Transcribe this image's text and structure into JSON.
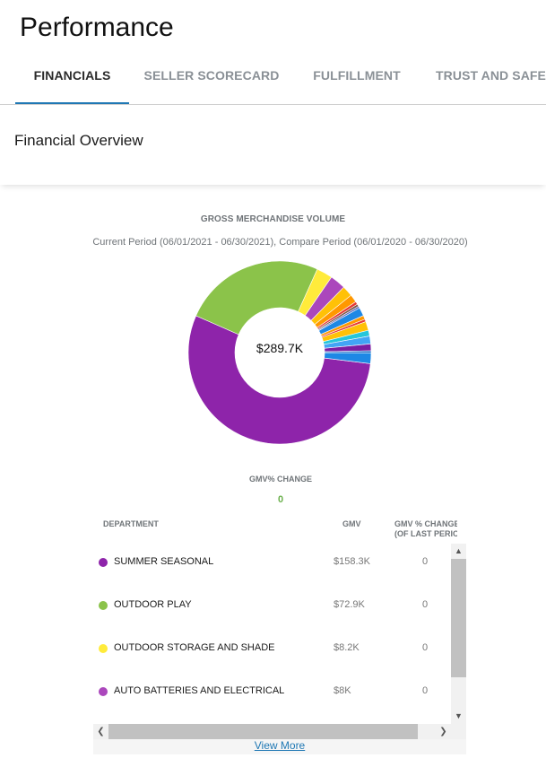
{
  "page": {
    "title": "Performance"
  },
  "tabs": [
    {
      "label": "FINANCIALS",
      "active": true
    },
    {
      "label": "SELLER SCORECARD",
      "active": false
    },
    {
      "label": "FULFILLMENT",
      "active": false
    },
    {
      "label": "TRUST AND SAFETY",
      "active": false
    }
  ],
  "section": {
    "title": "Financial Overview"
  },
  "gmv_chart": {
    "title": "GROSS MERCHANDISE VOLUME",
    "period": "Current Period (06/01/2021 - 06/30/2021), Compare Period (06/01/2020 - 06/30/2020)",
    "center_label": "$289.7K"
  },
  "gmv_change": {
    "label": "GMV% CHANGE",
    "value": "0"
  },
  "table": {
    "headers": {
      "department": "DEPARTMENT",
      "gmv": "GMV",
      "change": "GMV % CHANGE (OF LAST PERIOD)"
    },
    "rows": [
      {
        "department": "SUMMER SEASONAL",
        "gmv": "$158.3K",
        "change": "0",
        "color": "#8e24aa"
      },
      {
        "department": "OUTDOOR PLAY",
        "gmv": "$72.9K",
        "change": "0",
        "color": "#8bc34a"
      },
      {
        "department": "OUTDOOR STORAGE AND SHADE",
        "gmv": "$8.2K",
        "change": "0",
        "color": "#ffeb3b"
      },
      {
        "department": "AUTO BATTERIES AND ELECTRICAL",
        "gmv": "$8K",
        "change": "0",
        "color": "#ab47bc"
      }
    ]
  },
  "view_more": {
    "label": "View More"
  },
  "chart_data": {
    "type": "pie",
    "center_label": "$289.7K",
    "slices": [
      {
        "value": 158.3,
        "color": "#8e24aa",
        "name": "SUMMER SEASONAL"
      },
      {
        "value": 72.9,
        "color": "#8bc34a",
        "name": "OUTDOOR PLAY"
      },
      {
        "value": 8.2,
        "color": "#ffeb3b",
        "name": "OUTDOOR STORAGE AND SHADE"
      },
      {
        "value": 8.0,
        "color": "#ab47bc",
        "name": "AUTO BATTERIES AND ELECTRICAL"
      },
      {
        "value": 5.5,
        "color": "#ffc107"
      },
      {
        "value": 4.0,
        "color": "#ff9800"
      },
      {
        "value": 1.5,
        "color": "#e53935"
      },
      {
        "value": 1.2,
        "color": "#795548"
      },
      {
        "value": 1.0,
        "color": "#5c6bc0"
      },
      {
        "value": 4.3,
        "color": "#1e88e5"
      },
      {
        "value": 2.0,
        "color": "#ff9800"
      },
      {
        "value": 1.3,
        "color": "#e53935"
      },
      {
        "value": 4.5,
        "color": "#ffc107"
      },
      {
        "value": 3.0,
        "color": "#26c6da"
      },
      {
        "value": 4.0,
        "color": "#42a5f5"
      },
      {
        "value": 3.5,
        "color": "#7b1fa2"
      },
      {
        "value": 1.0,
        "color": "#1565c0"
      },
      {
        "value": 5.5,
        "color": "#1e88e5"
      }
    ]
  }
}
